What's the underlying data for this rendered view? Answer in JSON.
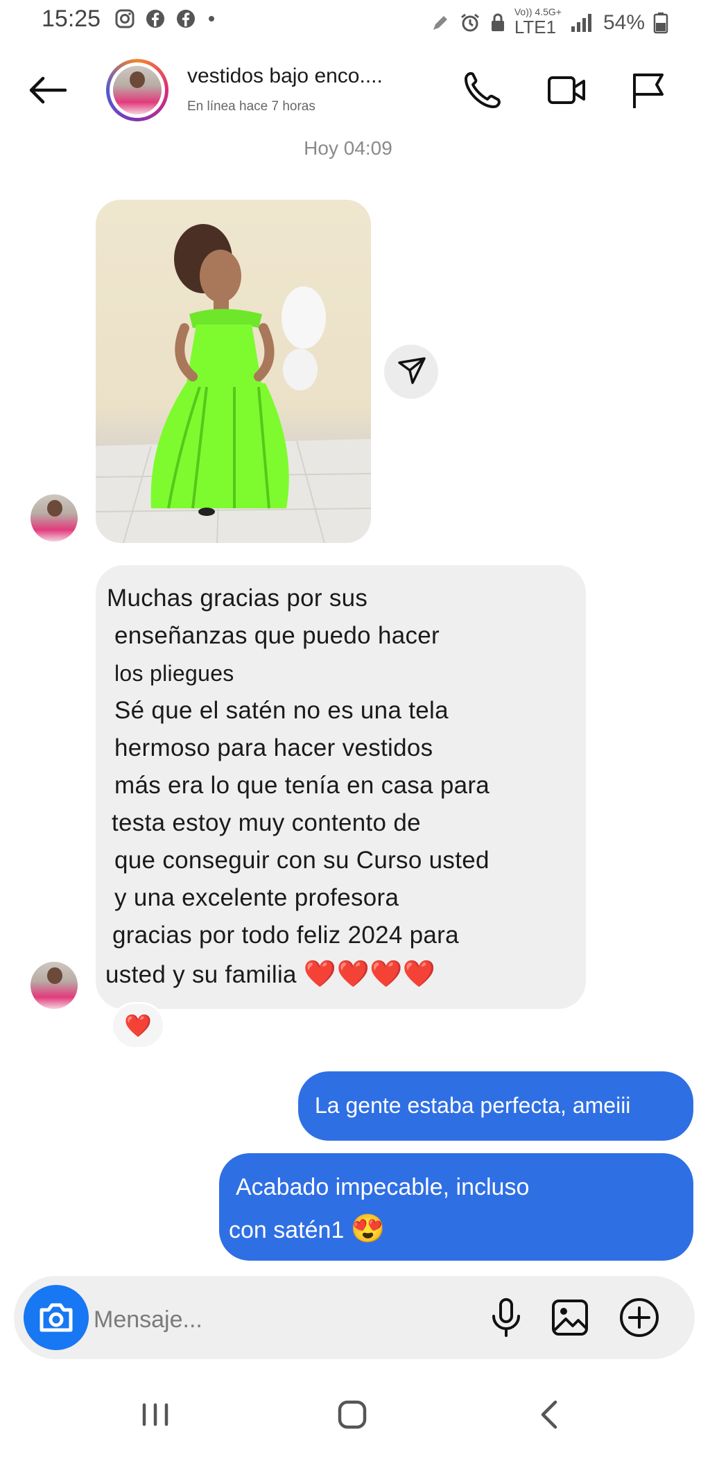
{
  "status_bar": {
    "time": "15:25",
    "network_small": "Vo)) 4.5G+",
    "network": "LTE1",
    "battery": "54%"
  },
  "header": {
    "contact_name": "vestidos bajo enco....",
    "contact_status": "En línea hace 7 horas",
    "icons": [
      "back-arrow-icon",
      "phone-icon",
      "video-camera-icon",
      "flag-icon"
    ]
  },
  "conversation": {
    "timestamp": "Hoy 04:09",
    "received_text_lines": [
      "Muchas gracias por sus",
      "enseñanzas que puedo hacer",
      "los pliegues",
      "Sé que el satén no es una tela",
      "hermoso para hacer vestidos",
      "más era lo que tenía en casa para",
      "testa estoy muy contento de",
      "que conseguir con su Curso usted",
      "y una excelente profesora",
      "gracias por todo feliz 2024 para",
      "usted y su familia"
    ],
    "received_emojis": "❤️❤️❤️❤️",
    "reaction": "❤️",
    "sent_1": "La gente estaba perfecta, ameiii",
    "sent_2_line1": "Acabado impecable, incluso",
    "sent_2_line2": "con satén1",
    "sent_2_emoji": "😍"
  },
  "composer": {
    "placeholder": "Mensaje..."
  },
  "colors": {
    "sent_bubble": "#2f6fe4",
    "received_bubble": "#efefef",
    "camera_button": "#1877f2",
    "dress_green": "#7dfb2e"
  }
}
